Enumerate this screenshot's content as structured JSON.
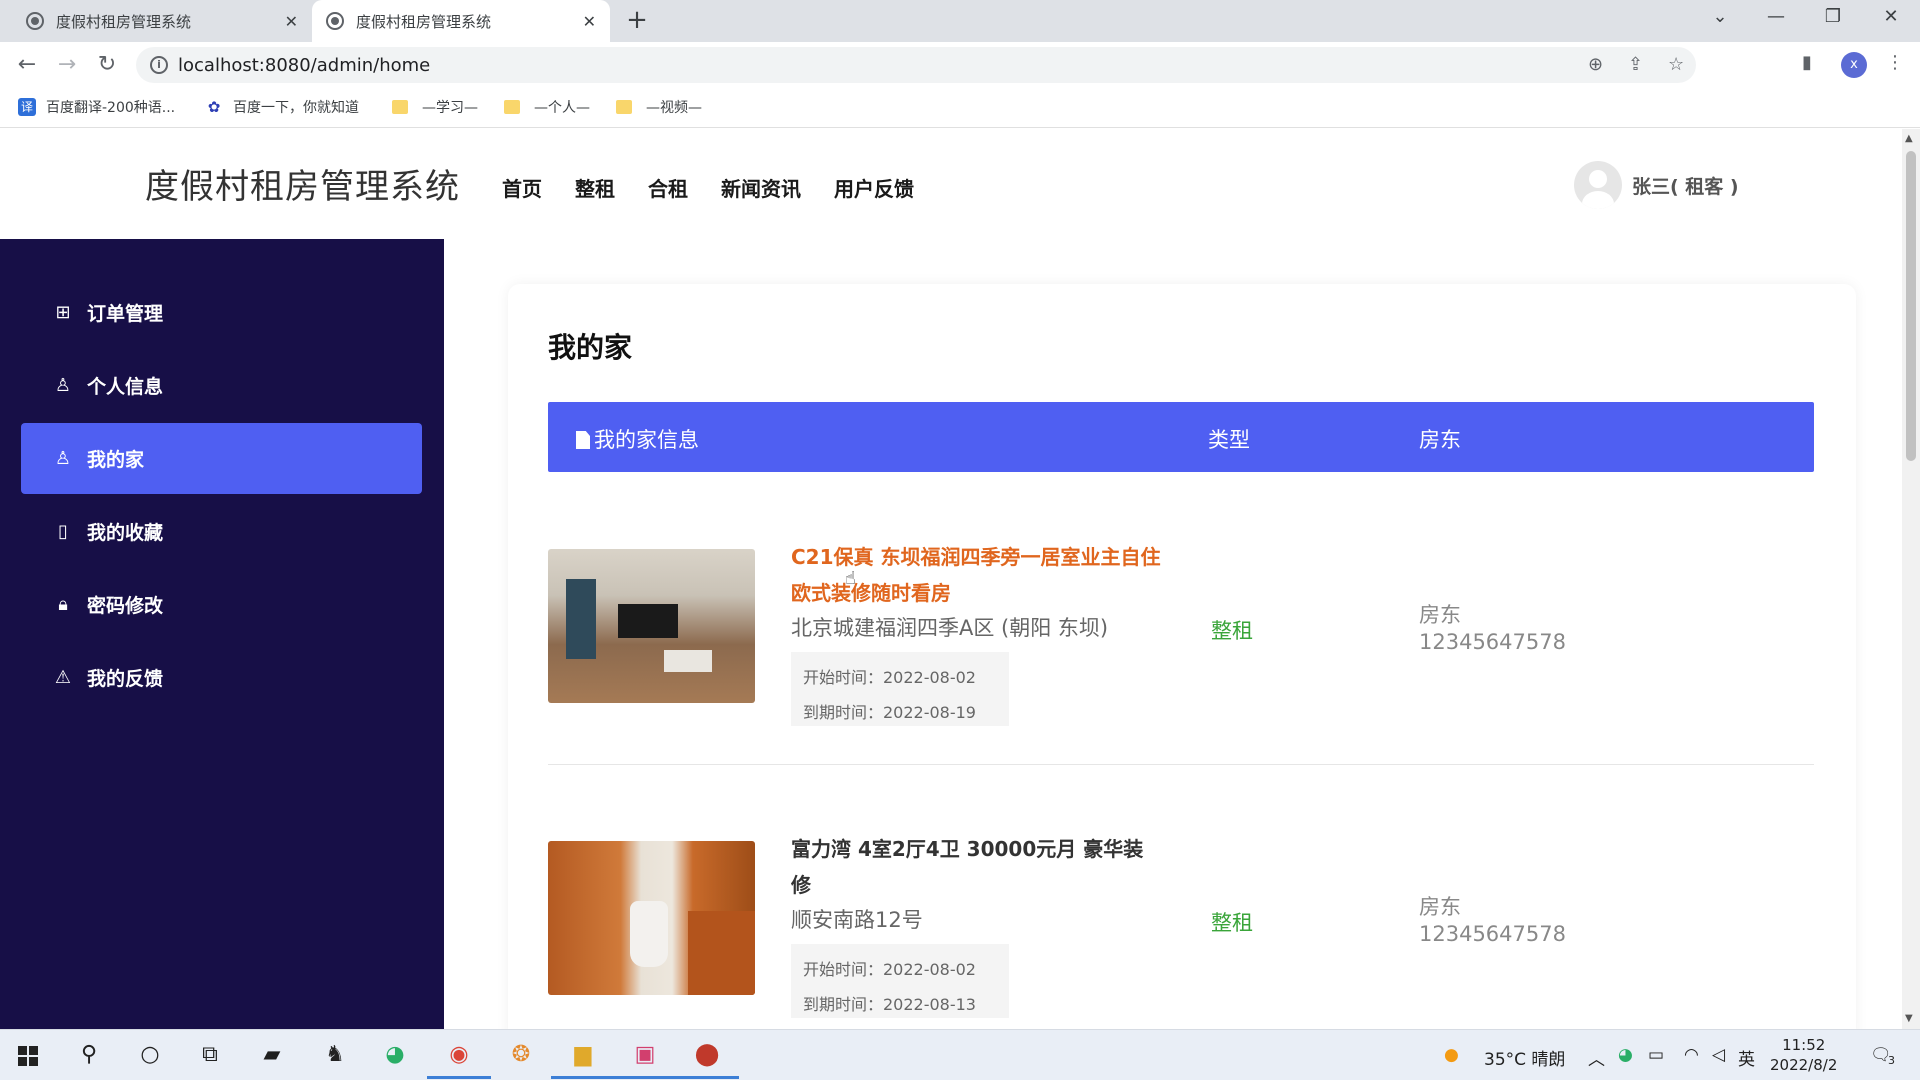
{
  "browser": {
    "tabs": [
      {
        "title": "度假村租房管理系统"
      },
      {
        "title": "度假村租房管理系统"
      }
    ],
    "url": "localhost:8080/admin/home",
    "profile_initial": "x",
    "bookmarks": [
      {
        "label": "百度翻译-200种语...",
        "icon": "译"
      },
      {
        "label": "百度一下，你就知道",
        "icon": "paw"
      },
      {
        "label": "—学习—",
        "icon": "folder"
      },
      {
        "label": "—个人—",
        "icon": "folder"
      },
      {
        "label": "—视频—",
        "icon": "folder"
      }
    ]
  },
  "site": {
    "title": "度假村租房管理系统",
    "nav": [
      "首页",
      "整租",
      "合租",
      "新闻资讯",
      "用户反馈"
    ],
    "user": "张三( 租客 )"
  },
  "sidebar": {
    "items": [
      {
        "label": "订单管理",
        "icon": "gift-icon",
        "active": false
      },
      {
        "label": "个人信息",
        "icon": "user-icon",
        "active": false
      },
      {
        "label": "我的家",
        "icon": "user-icon",
        "active": true
      },
      {
        "label": "我的收藏",
        "icon": "bookmark-icon",
        "active": false
      },
      {
        "label": "密码修改",
        "icon": "lock-icon",
        "active": false
      },
      {
        "label": "我的反馈",
        "icon": "warning-icon",
        "active": false
      }
    ]
  },
  "main": {
    "heading": "我的家",
    "columns": [
      "我的家信息",
      "类型",
      "房东"
    ],
    "rows": [
      {
        "title": "C21保真 东坝福润四季旁一居室业主自住欧式装修随时看房",
        "address": "北京城建福润四季A区 (朝阳 东坝)",
        "start": "开始时间：2022-08-02",
        "end": "到期时间：2022-08-19",
        "type": "整租",
        "landlord_label": "房东",
        "landlord_phone": "12345647578",
        "highlighted": true
      },
      {
        "title": "富力湾 4室2厅4卫 30000元月 豪华装修",
        "address": "顺安南路12号",
        "start": "开始时间：2022-08-02",
        "end": "到期时间：2022-08-13",
        "type": "整租",
        "landlord_label": "房东",
        "landlord_phone": "12345647578",
        "highlighted": false
      }
    ]
  },
  "taskbar": {
    "weather": "35°C  晴朗",
    "ime": "英",
    "time": "11:52",
    "date": "2022/8/2",
    "notifications": "3"
  },
  "colors": {
    "sidebar_bg": "#170f47",
    "accent": "#4f5ff2",
    "highlight_title": "#e0661e",
    "type_green": "#3aa53a"
  }
}
